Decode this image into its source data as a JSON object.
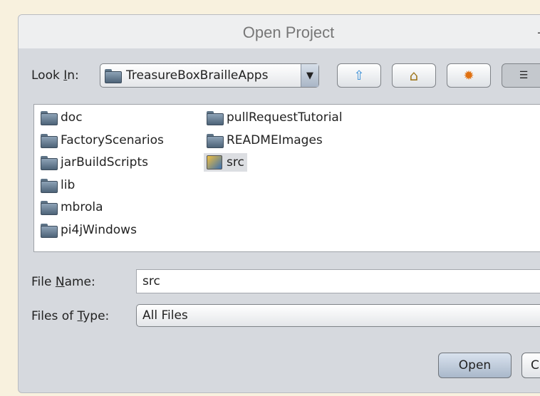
{
  "dialog": {
    "title": "Open Project"
  },
  "look_in": {
    "label_pre": "Look ",
    "label_mn": "I",
    "label_post": "n:",
    "value": "TreasureBoxBrailleApps"
  },
  "toolbar": [
    {
      "icon": "up-folder-icon"
    },
    {
      "icon": "home-icon"
    },
    {
      "icon": "new-folder-icon"
    },
    {
      "icon": "list-view-icon"
    }
  ],
  "files": [
    {
      "name": "doc",
      "type": "folder"
    },
    {
      "name": "FactoryScenarios",
      "type": "folder"
    },
    {
      "name": "jarBuildScripts",
      "type": "folder"
    },
    {
      "name": "lib",
      "type": "folder"
    },
    {
      "name": "mbrola",
      "type": "folder"
    },
    {
      "name": "pi4jWindows",
      "type": "folder"
    },
    {
      "name": "pullRequestTutorial",
      "type": "folder"
    },
    {
      "name": "READMEImages",
      "type": "folder"
    },
    {
      "name": "src",
      "type": "project",
      "selected": true
    }
  ],
  "file_name": {
    "label_pre": "File ",
    "label_mn": "N",
    "label_post": "ame:",
    "value": "src"
  },
  "file_type": {
    "label_pre": "Files of ",
    "label_mn": "T",
    "label_post": "ype:",
    "value": "All Files"
  },
  "buttons": {
    "open": "Open",
    "cancel": "C"
  }
}
